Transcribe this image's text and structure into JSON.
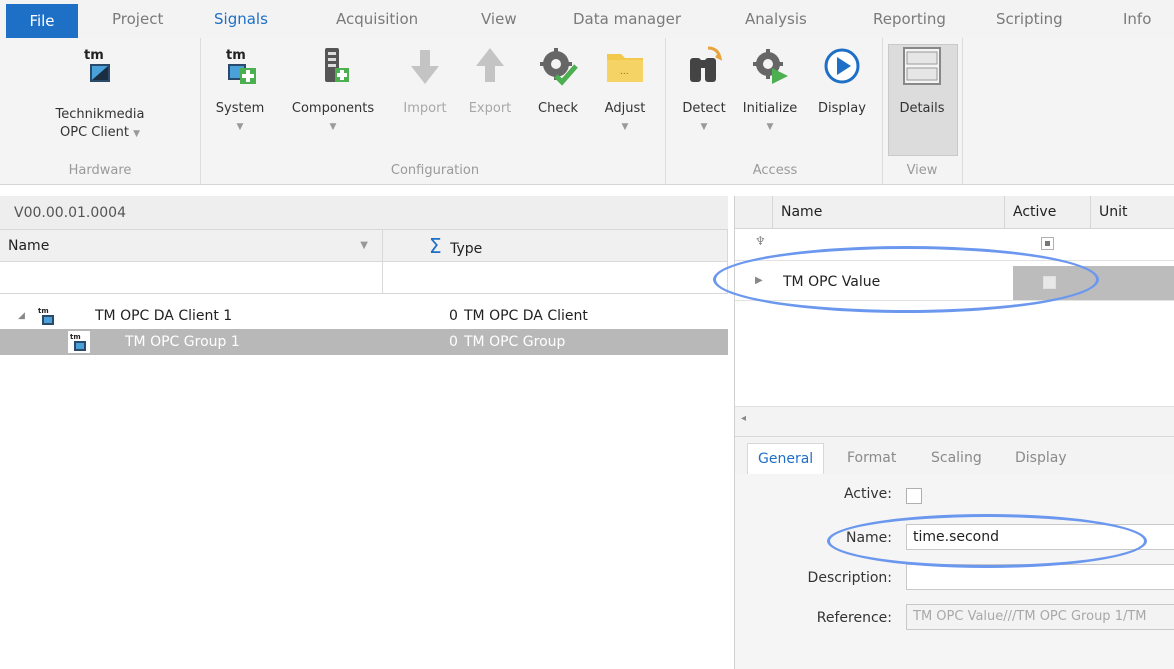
{
  "menu": {
    "file": "File",
    "tabs": [
      "Project",
      "Signals",
      "Acquisition",
      "View",
      "Data manager",
      "Analysis",
      "Reporting",
      "Scripting",
      "Info"
    ],
    "active": "Signals"
  },
  "ribbon": {
    "hardware": {
      "label": "Hardware",
      "button_line1": "Technikmedia",
      "button_line2": "OPC Client",
      "icon_text": "tm"
    },
    "configuration": {
      "label": "Configuration",
      "buttons": [
        "System",
        "Components",
        "Import",
        "Export",
        "Check",
        "Adjust"
      ],
      "system_icon_text": "tm"
    },
    "access": {
      "label": "Access",
      "buttons": [
        "Detect",
        "Initialize",
        "Display"
      ]
    },
    "view": {
      "label": "View",
      "buttons": [
        "Details"
      ]
    }
  },
  "tree": {
    "version": "V00.00.01.0004",
    "col_name": "Name",
    "col_type": "Type",
    "sigma": "Σ",
    "rows": [
      {
        "name": "TM OPC DA Client 1",
        "count": "0",
        "type": "TM OPC DA Client",
        "icon": "tm"
      },
      {
        "name": "TM OPC Group 1",
        "count": "0",
        "type": "TM OPC Group",
        "icon": "tm"
      }
    ]
  },
  "grid": {
    "col_name": "Name",
    "col_active": "Active",
    "col_unit": "Unit",
    "rows": [
      {
        "name": "TM OPC Value"
      }
    ]
  },
  "details": {
    "tabs": [
      "General",
      "Format",
      "Scaling",
      "Display"
    ],
    "active_label": "Active:",
    "name_label": "Name:",
    "name_value": "time.second",
    "description_label": "Description:",
    "description_value": "",
    "reference_label": "Reference:",
    "reference_value": "TM OPC Value///TM OPC Group 1/TM"
  },
  "colors": {
    "accent": "#1e6fc6",
    "highlight_ellipse": "#6b98ee",
    "selected_row": "#b8b8b8"
  }
}
